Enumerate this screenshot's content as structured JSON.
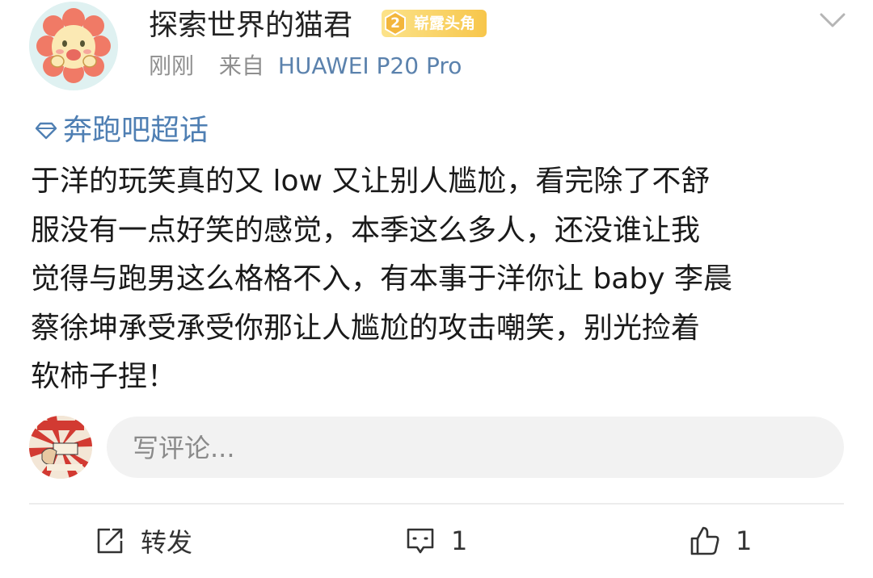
{
  "post": {
    "author": {
      "name": "探索世界的猫君",
      "badge_level": "2",
      "badge_label": "崭露头角"
    },
    "meta": {
      "time": "刚刚",
      "from_label": "来自",
      "device": "HUAWEI P20 Pro"
    },
    "topic": "奔跑吧超话",
    "body": "于洋的玩笑真的又 low 又让别人尴尬，看完除了不舒\n服没有一点好笑的感觉，本季这么多人，还没谁让我\n觉得与跑男这么格格不入，有本事于洋你让 baby 李晨\n蔡徐坤承受承受你那让人尴尬的攻击嘲笑，别光捡着\n软柿子捏！"
  },
  "comment_input": {
    "placeholder": "写评论..."
  },
  "actions": {
    "repost_label": "转发",
    "comment_count": "1",
    "like_count": "1"
  },
  "colors": {
    "link_blue": "#4f7fb3",
    "device_blue": "#5b82ad",
    "badge_gold": "#f7c64b",
    "meta_gray": "#8f8f8f"
  },
  "icons": [
    "user-avatar",
    "badge-icon",
    "chevron-down-icon",
    "diamond-icon",
    "commenter-avatar",
    "repost-icon",
    "comment-icon",
    "like-icon"
  ]
}
